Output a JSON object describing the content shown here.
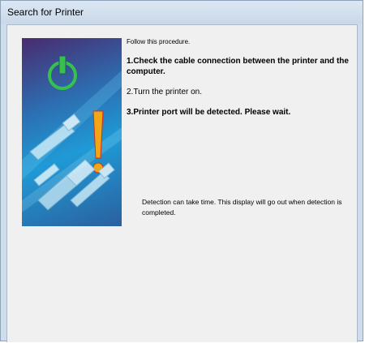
{
  "window": {
    "title": "Search for Printer"
  },
  "instructions": {
    "intro": "Follow this procedure.",
    "steps": [
      "1.Check the cable connection between the printer and the computer.",
      "2.Turn the printer on.",
      "3.Printer port will be detected. Please wait."
    ],
    "note": "Detection can take time. This display will go out when detection is completed."
  },
  "illustration": {
    "icons": [
      "power-icon",
      "warning-exclamation-icon",
      "usb-cable-icon",
      "parallel-cable-icon"
    ],
    "colors": {
      "power_symbol": "#36c24a",
      "exclamation": "#f2a516",
      "background": "#1f9ad6"
    }
  }
}
